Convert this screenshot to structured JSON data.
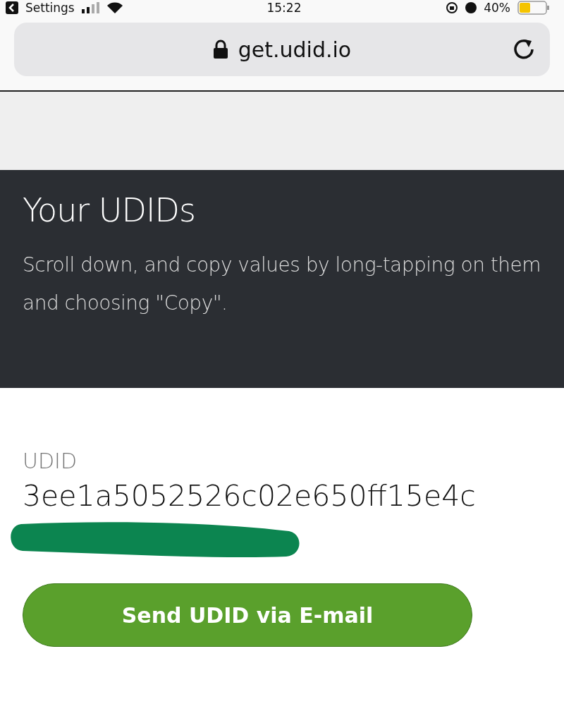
{
  "status_bar": {
    "back_label": "Settings",
    "time": "15:22",
    "battery": "40%"
  },
  "address_bar": {
    "url": "get.udid.io"
  },
  "header": {
    "title": "Your UDIDs",
    "description": "Scroll down, and copy values by long-tapping on them and choosing \"Copy\"."
  },
  "udid": {
    "label": "UDID",
    "value": "3ee1a5052526c02e650ff15e4c"
  },
  "button": {
    "label": "Send UDID via E-mail"
  }
}
